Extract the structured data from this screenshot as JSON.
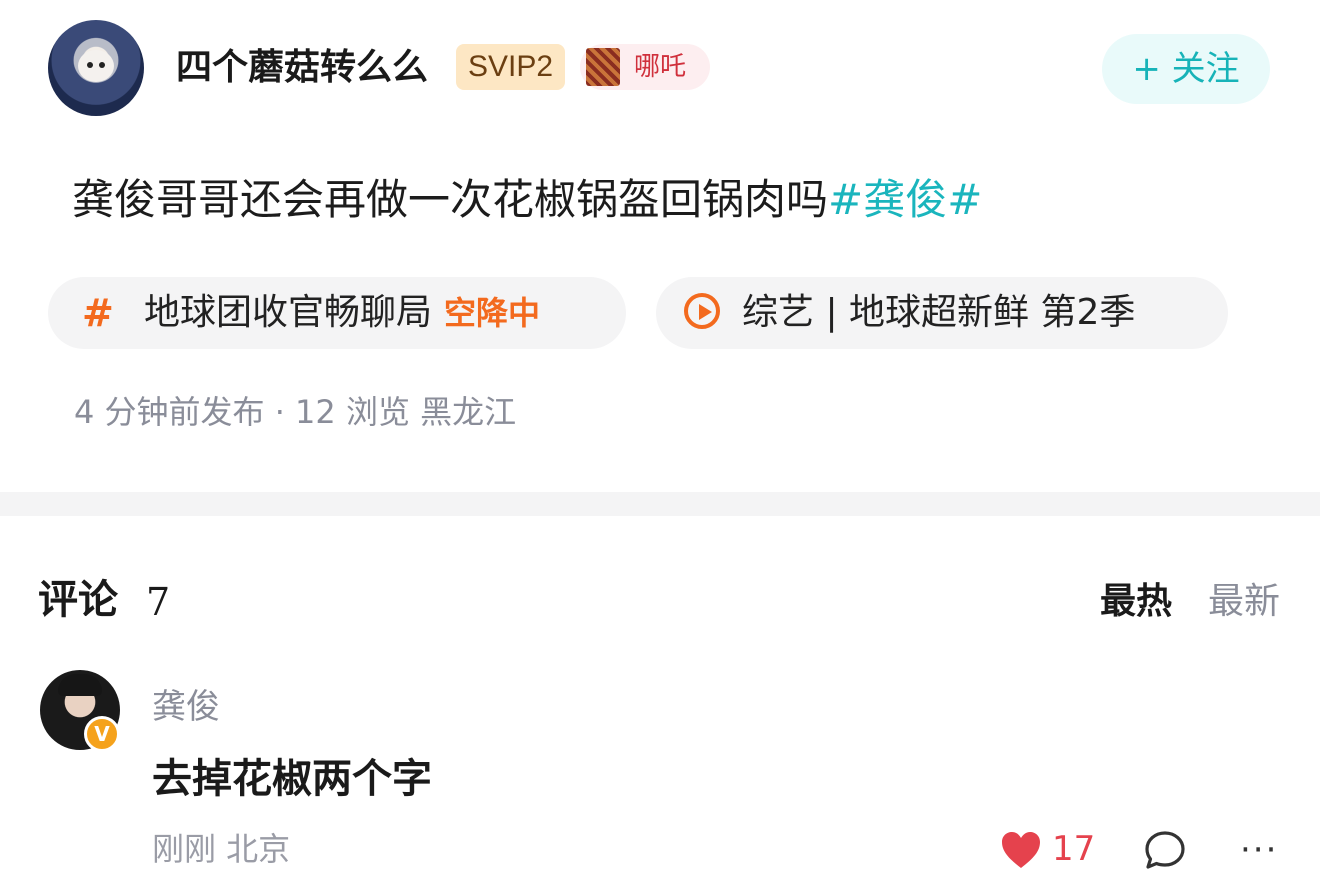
{
  "post": {
    "author": {
      "username": "四个蘑菇转么么",
      "vip_badge": "SVIP2",
      "fan_badge": "哪吒",
      "follow_label": "+ 关注"
    },
    "text": "龚俊哥哥还会再做一次花椒锅盔回锅肉吗",
    "hashtag": "#龚俊#",
    "topic_pill": {
      "icon": "hash-icon",
      "label": "地球团收官畅聊局",
      "tag": "空降中"
    },
    "show_pill": {
      "icon": "play-icon",
      "label": "综艺 | 地球超新鲜 第2季"
    },
    "meta": "4 分钟前发布 · 12 浏览 黑龙江"
  },
  "comments": {
    "title": "评论",
    "count": "7",
    "sort_hot": "最热",
    "sort_new": "最新",
    "items": [
      {
        "author": "龚俊",
        "verified_icon": "v-badge-icon",
        "text": "去掉花椒两个字",
        "meta": "刚刚 北京",
        "likes": "17"
      }
    ]
  },
  "colors": {
    "accent": "#1ab5bd",
    "orange": "#f36a1e",
    "like": "#e5424d",
    "muted": "#8a8d99"
  }
}
